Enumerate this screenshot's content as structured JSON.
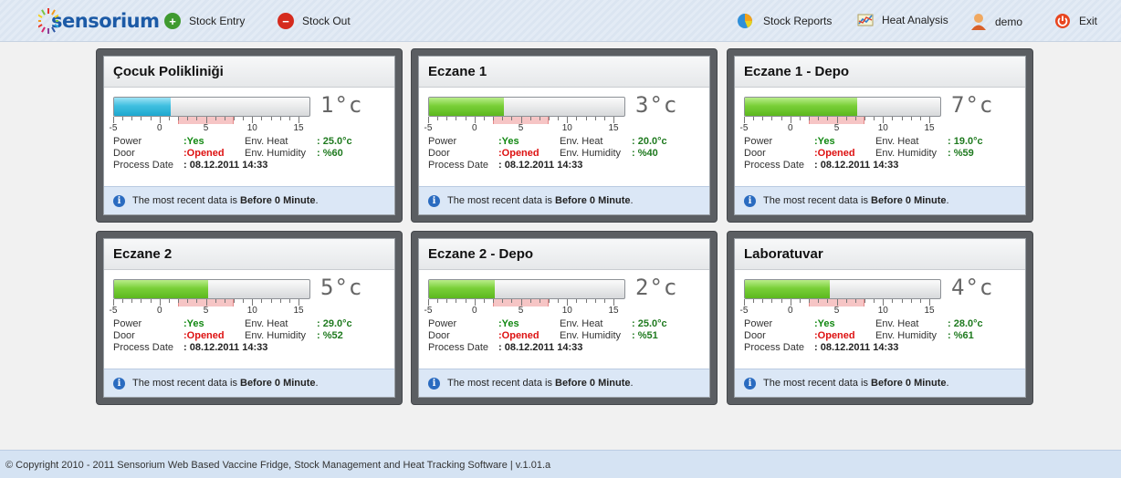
{
  "app": {
    "logo_text": "sensorium"
  },
  "nav_left": [
    {
      "label": "Stock Entry",
      "icon": "plus-circle-icon",
      "color": "#3f9a2f"
    },
    {
      "label": "Stock Out",
      "icon": "minus-circle-icon",
      "color": "#d52b1e"
    }
  ],
  "nav_right": [
    {
      "label": "Stock Reports",
      "icon": "pie-chart-icon"
    },
    {
      "label": "Heat Analysis",
      "icon": "chart-icon"
    },
    {
      "label": "demo",
      "icon": "user-icon"
    },
    {
      "label": "Exit",
      "icon": "power-icon"
    }
  ],
  "gauge_scale": {
    "labels": [
      "-5",
      "0",
      "5",
      "10",
      "15"
    ],
    "min": -5,
    "max": 16,
    "safe_range": [
      2,
      8
    ]
  },
  "field_labels": {
    "power": "Power",
    "door": "Door",
    "process_date": "Process Date",
    "env_heat": "Env. Heat",
    "env_humidity": "Env. Humidity",
    "footer_prefix": "The most recent data is ",
    "footer_bold": "Before 0 Minute",
    "footer_suffix": "."
  },
  "devices": [
    {
      "name": "Çocuk Polikliniği",
      "temp": "1°c",
      "level": 1,
      "bar": "blue",
      "power": ":Yes",
      "door": ":Opened",
      "date": ": 08.12.2011 14:33",
      "env_heat": ": 25.0°c",
      "humidity": ": %60"
    },
    {
      "name": "Eczane 1",
      "temp": "3°c",
      "level": 3,
      "bar": "green",
      "power": ":Yes",
      "door": ":Opened",
      "date": ": 08.12.2011 14:33",
      "env_heat": ": 20.0°c",
      "humidity": ": %40"
    },
    {
      "name": "Eczane 1 - Depo",
      "temp": "7°c",
      "level": 7,
      "bar": "green",
      "power": ":Yes",
      "door": ":Opened",
      "date": ": 08.12.2011 14:33",
      "env_heat": ": 19.0°c",
      "humidity": ": %59"
    },
    {
      "name": "Eczane 2",
      "temp": "5°c",
      "level": 5,
      "bar": "green",
      "power": ":Yes",
      "door": ":Opened",
      "date": ": 08.12.2011 14:33",
      "env_heat": ": 29.0°c",
      "humidity": ": %52"
    },
    {
      "name": "Eczane 2 - Depo",
      "temp": "2°c",
      "level": 2,
      "bar": "green",
      "power": ":Yes",
      "door": ":Opened",
      "date": ": 08.12.2011 14:33",
      "env_heat": ": 25.0°c",
      "humidity": ": %51"
    },
    {
      "name": "Laboratuvar",
      "temp": "4°c",
      "level": 4,
      "bar": "green",
      "power": ":Yes",
      "door": ":Opened",
      "date": ": 08.12.2011 14:33",
      "env_heat": ": 28.0°c",
      "humidity": ": %61"
    }
  ],
  "footer": {
    "copyright": "© Copyright 2010 - 2011 Sensorium Web Based Vaccine Fridge, Stock Management and Heat Tracking Software | v.1.01.a"
  }
}
